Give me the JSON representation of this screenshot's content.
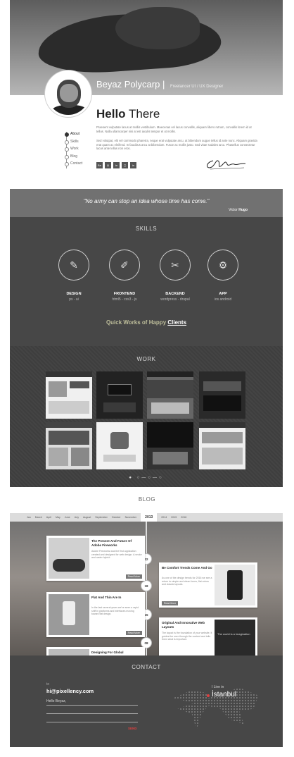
{
  "hero": {
    "name": "Beyaz Polycarp",
    "role": "Freelancer UI / UX Designer"
  },
  "about": {
    "nav": [
      "About",
      "Skills",
      "Work",
      "Blog",
      "Contact"
    ],
    "hello_bold": "Hello",
    "hello_rest": " There",
    "para1": "Praesent vulputate lacus at mollis vestibulum. Maecenas vel lacus convallis, aliquam libero rutrum, convallis lorem id at tellus. Nulla ullamcorper nisi at est iaculis tempor et ut mollis.",
    "para2": "Sed volutpat, elit vel commodo pharetra, neque erat vulputate arcu, at bibendum augue tellus id ante nunc. Aliquam gravida erat quam ac eleifend. In faucibus arcu at bibendum. Fusce ac mollis justo. Sed vitae sodales arcu. Phasellus consectetur lacus ante tellus non eros.",
    "socials": [
      "Be",
      "◎",
      "in",
      "▢",
      "in"
    ]
  },
  "quote": {
    "text": "\"No army can stop an idea whose time has come.\"",
    "author_first": "Victor ",
    "author_last": "Hugo"
  },
  "skills": {
    "title": "SKILLS",
    "items": [
      {
        "name": "DESIGN",
        "desc": "ps - ai",
        "icon": "✎"
      },
      {
        "name": "FRONTEND",
        "desc": "html5 - css3 - js",
        "icon": "✐"
      },
      {
        "name": "BACKEND",
        "desc": "wordpress - drupal",
        "icon": "✂"
      },
      {
        "name": "APP",
        "desc": "ios android",
        "icon": "⚙"
      }
    ],
    "clients_pre": "Quick Works of Happy ",
    "clients_link": "Clients"
  },
  "work": {
    "title": "WORK",
    "pager": "● ○—○—○"
  },
  "blog": {
    "title": "BLOG",
    "months": [
      "Jan",
      "March",
      "April",
      "May",
      "June",
      "July",
      "August",
      "September",
      "October",
      "November"
    ],
    "year": "2013",
    "future": [
      "2014",
      "2015",
      "2016"
    ],
    "dots": [
      "22",
      "18",
      "15",
      "08"
    ],
    "posts": [
      {
        "title": "The Present And Future Of Adobe Fireworks",
        "text": "Adobe Fireworks was the first application created and designed for web design. A vector and raster hybrid.",
        "more": "Read More"
      },
      {
        "title": "Be Comfort Trends Come And Go",
        "text": "As one of the design trends for 2016 we see a return to simple and clean forms, flat colors and classic layouts.",
        "more": "Read More"
      },
      {
        "title": "Flat And Thin Are In",
        "text": "In the last several years we've seen a rapid shift in platforms and interfaces moving toward flat design.",
        "more": "Read More"
      },
      {
        "title": "Original And Innovative Web Layouts",
        "text": "The layout is the foundation of your website. It guides the user through the content and tells them what is important.",
        "more": "Read More"
      },
      {
        "title": "Designing For Global",
        "text": "",
        "more": ""
      }
    ],
    "dark_post_text": "The world is a imagination"
  },
  "contact": {
    "title": "CONTACT",
    "to": "to",
    "email": "hi@pixellency.com",
    "hello": "Hello Beyaz,",
    "send": "SEND",
    "live": "I Live in",
    "city": "İstanbul"
  }
}
